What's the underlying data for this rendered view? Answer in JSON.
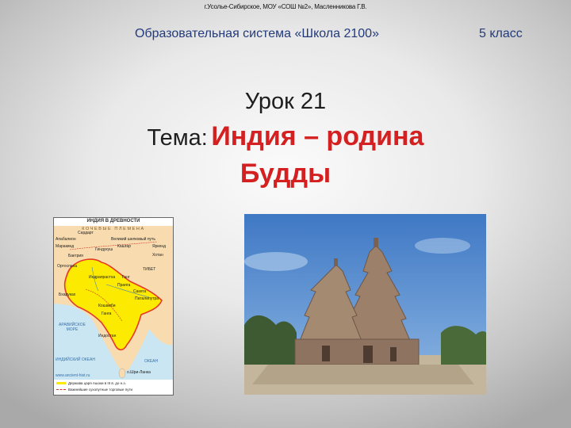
{
  "slide": {
    "author_line": "г.Усолье-Сибирское, МОУ «СОШ №2», Масленникова Г.В.",
    "program": "Образовательная система «Школа 2100»",
    "grade": "5 класс",
    "lesson": "Урок 21",
    "topic_prefix": "Тема:",
    "topic_main": "Индия – родина",
    "topic_line2": "Будды"
  },
  "map": {
    "title": "ИНДИЯ В ДРЕВНОСТИ",
    "top_band": "КОЧЕВЫЕ ПЛЕМЕНА",
    "places": [
      "Сардарт",
      "Апабалион",
      "Маракинд",
      "Бактрия",
      "Гиндукуш",
      "Великий шелковый путь",
      "Кашгар",
      "Яркенд",
      "Хотан",
      "Ортоспана",
      "ТИБЕТ",
      "Индрапрастха",
      "Ганг",
      "Праяга",
      "Сакета",
      "Паталипутра",
      "Бхаруках",
      "Кошамби",
      "Ганга",
      "Индостан",
      "о.Шри-Ланка"
    ],
    "seas": {
      "arabian": "АРАВИЙСКОЕ МОРЕ",
      "indian_ocean": "ИНДИЙСКИЙ ОКЕАН",
      "ocean_word": "ОКЕАН"
    },
    "site": "www.ancient-hist.ru",
    "legend": [
      "Держава царя Ашоки в III в. до н.э.",
      "Важнейшие сухопутные торговые пути"
    ],
    "colors": {
      "empire": "#fcea00",
      "border": "#e53a26",
      "land": "#f8dcb0",
      "sea": "#c9e6f2"
    }
  },
  "photo": {
    "icon": "temple-photo",
    "colors": {
      "sky": "#4f86cc",
      "stone": "#9c8069",
      "foliage": "#3e5a32",
      "ground": "#c4b69c"
    }
  }
}
